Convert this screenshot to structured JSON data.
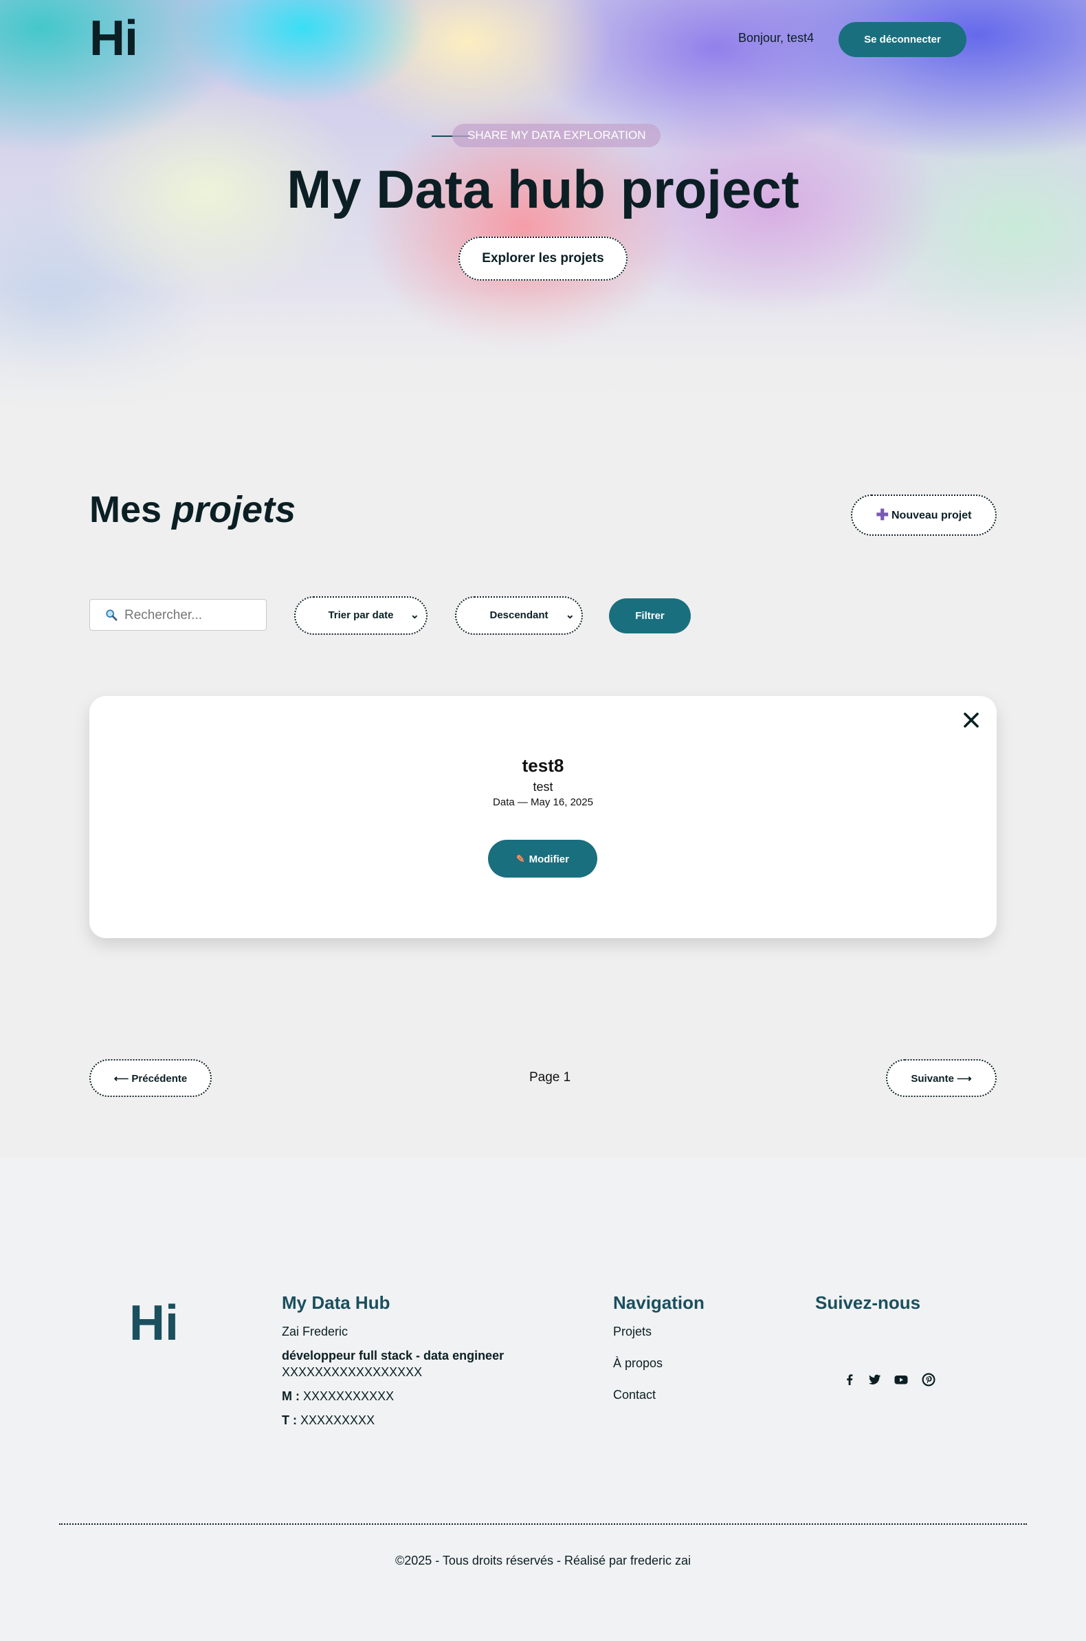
{
  "header": {
    "logo": "Hi",
    "greeting": "Bonjour, test4",
    "logout_label": "Se déconnecter"
  },
  "hero": {
    "eyebrow": "SHARE MY DATA EXPLORATION",
    "title": "My Data hub project",
    "cta_label": "Explorer les projets"
  },
  "projects": {
    "title_plain": "Mes",
    "title_italic": "projets",
    "new_label": "Nouveau projet",
    "search_placeholder": "Rechercher...",
    "sort_selected": "Trier par date",
    "order_selected": "Descendant",
    "filter_label": "Filtrer",
    "items": [
      {
        "title": "test8",
        "description": "test",
        "meta": "Data — May 16, 2025",
        "edit_label": "Modifier"
      }
    ],
    "pagination": {
      "prev_label": "⟵ Précédente",
      "page_label": "Page 1",
      "next_label": "Suivante ⟶"
    }
  },
  "footer": {
    "logo": "Hi",
    "about_heading": "My Data Hub",
    "name": "Zai Frederic",
    "role": "développeur full stack - data engineer",
    "address": "XXXXXXXXXXXXXXXXX",
    "mobile_label": "M :",
    "mobile_value": "XXXXXXXXXXX",
    "phone_label": "T :",
    "phone_value": "XXXXXXXXX",
    "nav_heading": "Navigation",
    "nav_links": [
      "Projets",
      "À propos",
      "Contact"
    ],
    "social_heading": "Suivez-nous",
    "social_icons": [
      "facebook-icon",
      "twitter-icon",
      "youtube-icon",
      "pinterest-icon"
    ],
    "copyright": "©2025 - Tous droits réservés - Réalisé par frederic zai"
  },
  "colors": {
    "primary": "#1a6f7e",
    "heading": "#0b1f24",
    "footer_heading": "#1a4f5e",
    "background": "#efefef"
  }
}
